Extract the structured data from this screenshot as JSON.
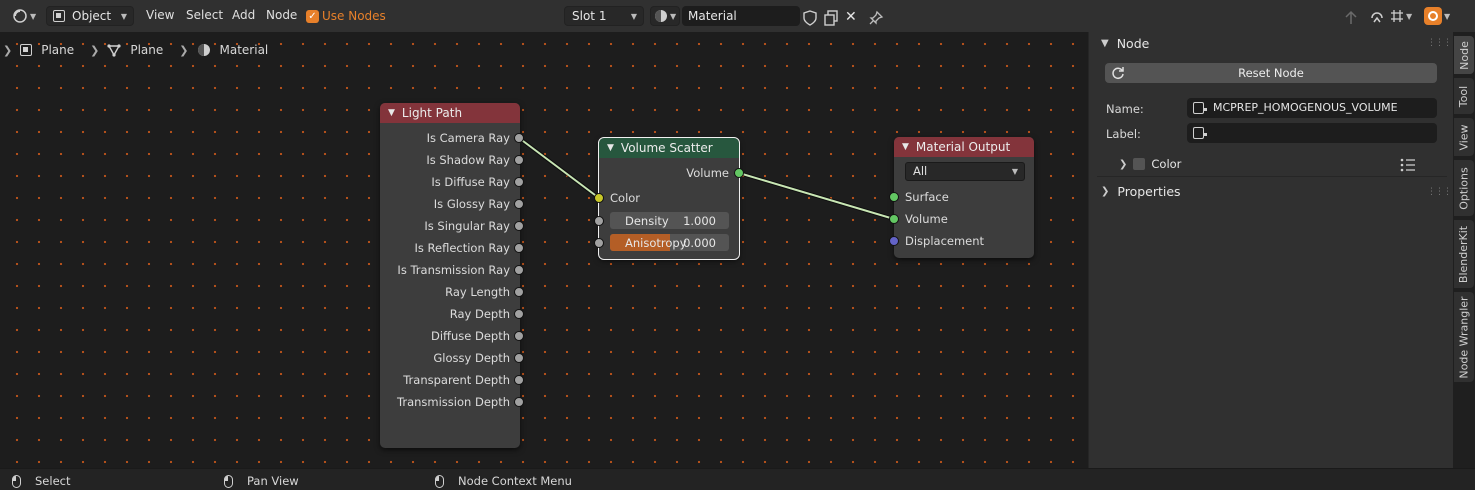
{
  "header": {
    "mode": "Object",
    "menus": [
      "View",
      "Select",
      "Add",
      "Node"
    ],
    "use_nodes_label": "Use Nodes",
    "use_nodes_checked": true,
    "slot": "Slot 1",
    "material_name": "Material"
  },
  "breadcrumb": [
    "Plane",
    "Plane",
    "Material"
  ],
  "nodes": {
    "light_path": {
      "title": "Light Path",
      "outputs": [
        "Is Camera Ray",
        "Is Shadow Ray",
        "Is Diffuse Ray",
        "Is Glossy Ray",
        "Is Singular Ray",
        "Is Reflection Ray",
        "Is Transmission Ray",
        "Ray Length",
        "Ray Depth",
        "Diffuse Depth",
        "Glossy Depth",
        "Transparent Depth",
        "Transmission Depth"
      ]
    },
    "volume_scatter": {
      "title": "Volume Scatter",
      "output": "Volume",
      "color_label": "Color",
      "density_label": "Density",
      "density_value": "1.000",
      "anisotropy_label": "Anisotropy",
      "anisotropy_value": "0.000",
      "anisotropy_fill": 0.5
    },
    "material_output": {
      "title": "Material Output",
      "target": "All",
      "inputs": [
        "Surface",
        "Volume",
        "Displacement"
      ]
    }
  },
  "panel": {
    "section": "Node",
    "reset_label": "Reset Node",
    "name_label": "Name:",
    "name_value": "MCPREP_HOMOGENOUS_VOLUME",
    "label_label": "Label:",
    "label_value": "",
    "color_label": "Color",
    "properties_label": "Properties"
  },
  "tabs": [
    "Node",
    "Tool",
    "View",
    "Options",
    "BlenderKit",
    "Node Wrangler"
  ],
  "status": [
    "Select",
    "Pan View",
    "Node Context Menu"
  ],
  "colors": {
    "accent": "#e7802a",
    "grid_dot": "#c2561b",
    "header_red": "#83343b",
    "header_green": "#27573e",
    "link": "#c8e6b4"
  }
}
